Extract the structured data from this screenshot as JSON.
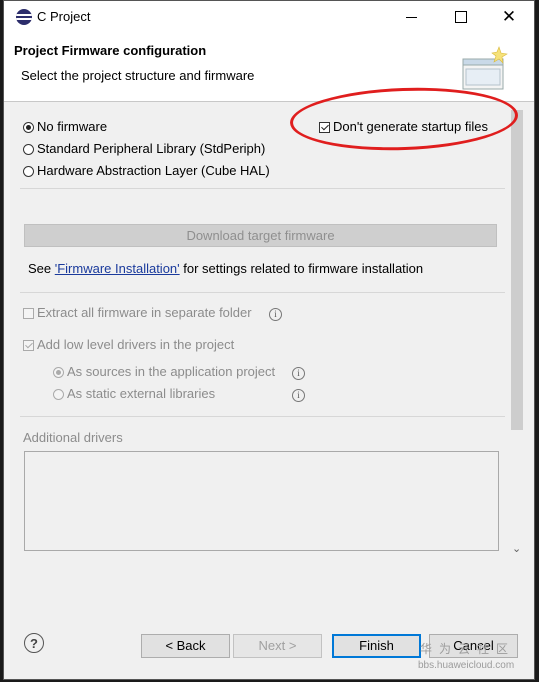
{
  "window": {
    "title": "C Project"
  },
  "titlebar": {
    "minimize_glyph": "—",
    "maximize_glyph": "☐",
    "close_glyph": "✕"
  },
  "header": {
    "title": "Project Firmware configuration",
    "subtitle": "Select the project structure and firmware"
  },
  "firmware": {
    "options": [
      {
        "label": "No firmware",
        "selected": true
      },
      {
        "label": "Standard Peripheral Library (StdPeriph)",
        "selected": false
      },
      {
        "label": "Hardware Abstraction Layer (Cube HAL)",
        "selected": false
      }
    ],
    "startup_checkbox": {
      "label": "Don't generate startup files",
      "checked": true
    }
  },
  "download": {
    "button_label": "Download target firmware"
  },
  "see_text": {
    "prefix": "See ",
    "link": "'Firmware Installation'",
    "suffix": " for settings related to firmware installation"
  },
  "options": {
    "extract_label": "Extract all firmware in separate folder",
    "extract_checked": false,
    "add_drivers_label": "Add low level drivers in the project",
    "add_drivers_checked": true,
    "as_sources_label": "As sources in the application project",
    "as_sources_selected": true,
    "as_static_label": "As static external libraries",
    "as_static_selected": false,
    "info_glyph": "i"
  },
  "additional_drivers": {
    "label": "Additional drivers"
  },
  "footer": {
    "help_glyph": "?",
    "back_label": "< Back",
    "next_label": "Next >",
    "finish_label": "Finish",
    "cancel_label": "Cancel"
  },
  "watermark": {
    "cn": "华为云社区",
    "url": "bbs.huaweicloud.com"
  },
  "colors": {
    "highlight": "#e01e1e",
    "link": "#1a3a9c",
    "default_button_border": "#0078d7"
  },
  "icons": {
    "app": "eclipse-icon",
    "wizard": "wizard-banner-icon",
    "info": "info-icon",
    "help": "help-icon"
  }
}
